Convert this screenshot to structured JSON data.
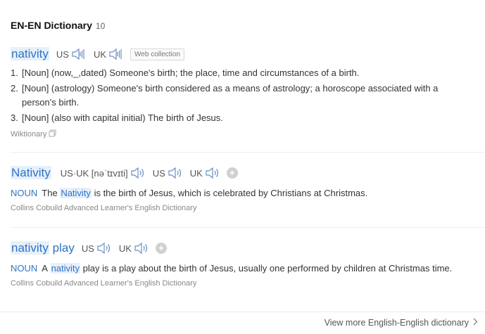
{
  "header": {
    "title": "EN-EN Dictionary",
    "count": "10"
  },
  "entry1": {
    "headword": "nativity",
    "us": "US",
    "uk": "UK",
    "tag": "Web collection",
    "defs": [
      {
        "num": "1.",
        "text": "[Noun] (now,_,dated) Someone's birth; the place, time and circumstances of a birth."
      },
      {
        "num": "2.",
        "text": "[Noun] (astrology) Someone's birth considered as a means of astrology; a horoscope associated with a person's birth."
      },
      {
        "num": "3.",
        "text": "[Noun] (also with capital initial) The birth of Jesus."
      }
    ],
    "source": "Wiktionary"
  },
  "entry2": {
    "headword": "Nativity",
    "phonetic": "US·UK [nəˈtɪvɪti]",
    "us": "US",
    "uk": "UK",
    "pos": "NOUN",
    "def_pre": "The",
    "def_word": "Nativity",
    "def_post": "is the birth of Jesus, which is celebrated by Christians at Christmas.",
    "source": "Collins Cobuild Advanced Learner's English Dictionary"
  },
  "entry3": {
    "headword_a": "nativity",
    "headword_b": "play",
    "us": "US",
    "uk": "UK",
    "pos": "NOUN",
    "def_pre": "A",
    "def_word": "nativity",
    "def_post": "play is a play about the birth of Jesus, usually one performed by children at Christmas time.",
    "source": "Collins Cobuild Advanced Learner's English Dictionary"
  },
  "footer": {
    "more_label": "View more English-English dictionary"
  },
  "icons": {
    "speaker": "speaker-icon",
    "plus": "add-icon",
    "copy": "copy-icon",
    "chevron": "chevron-right-icon"
  },
  "colors": {
    "accent": "#2f73c6",
    "highlight": "#e6f0fb"
  }
}
